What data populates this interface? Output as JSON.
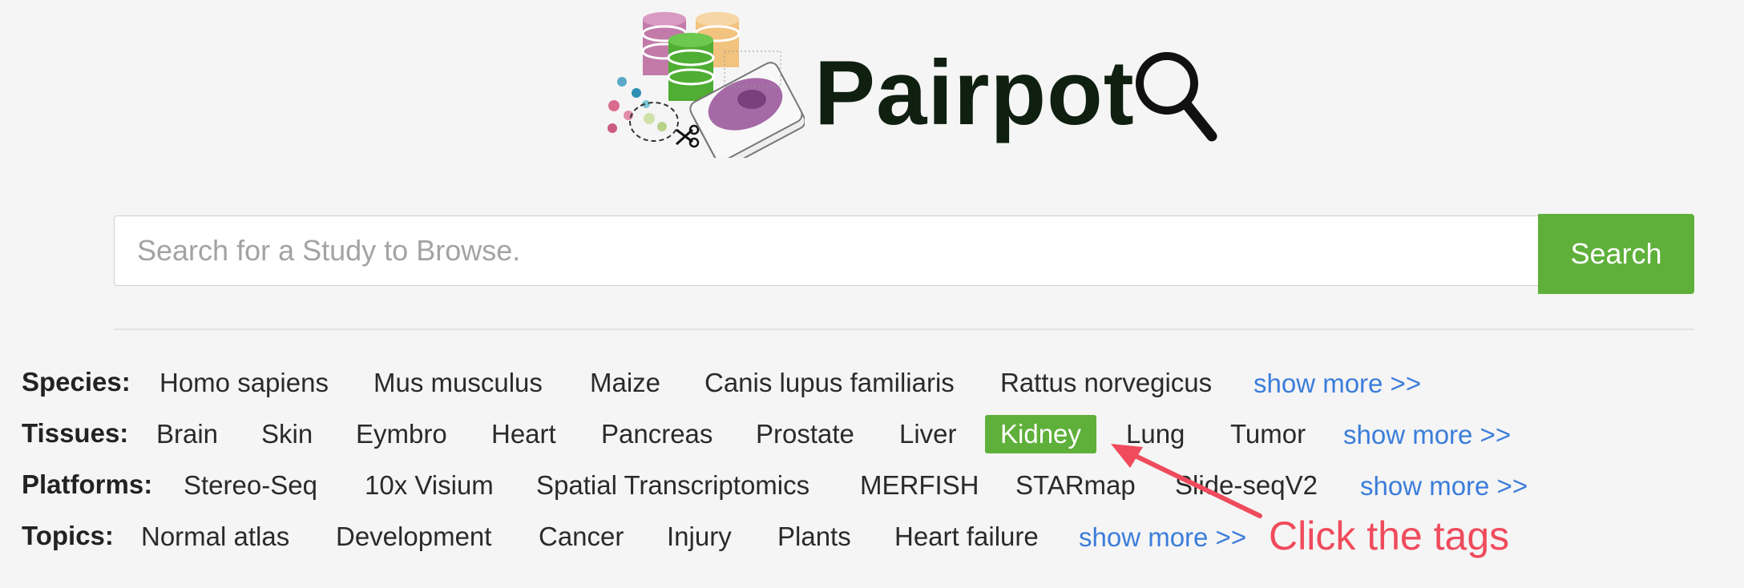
{
  "brand": {
    "name": "Pairpot"
  },
  "search": {
    "placeholder": "Search for a Study to Browse.",
    "value": "",
    "button_label": "Search"
  },
  "filters": {
    "species": {
      "label": "Species:",
      "tags": [
        "Homo sapiens",
        "Mus musculus",
        "Maize",
        "Canis lupus familiaris",
        "Rattus norvegicus"
      ],
      "more": "show more >>"
    },
    "tissues": {
      "label": "Tissues:",
      "tags": [
        "Brain",
        "Skin",
        "Eymbro",
        "Heart",
        "Pancreas",
        "Prostate",
        "Liver",
        "Kidney",
        "Lung",
        "Tumor"
      ],
      "active": "Kidney",
      "more": "show more >>"
    },
    "platforms": {
      "label": "Platforms:",
      "tags": [
        "Stereo-Seq",
        "10x Visium",
        "Spatial Transcriptomics",
        "MERFISH",
        "STARmap",
        "Slide-seqV2"
      ],
      "more": "show more >>"
    },
    "topics": {
      "label": "Topics:",
      "tags": [
        "Normal atlas",
        "Development",
        "Cancer",
        "Injury",
        "Plants",
        "Heart failure"
      ],
      "more": "show more >>"
    }
  },
  "annotation": {
    "text": "Click the tags"
  },
  "colors": {
    "accent": "#5fb03a",
    "link": "#3b7ddb",
    "annotation": "#ef4b5c",
    "background": "#f5f5f5"
  },
  "icons": [
    "database-icon",
    "cells-icon",
    "scissors-icon",
    "tissue-slide-icon",
    "magnifier-icon"
  ]
}
